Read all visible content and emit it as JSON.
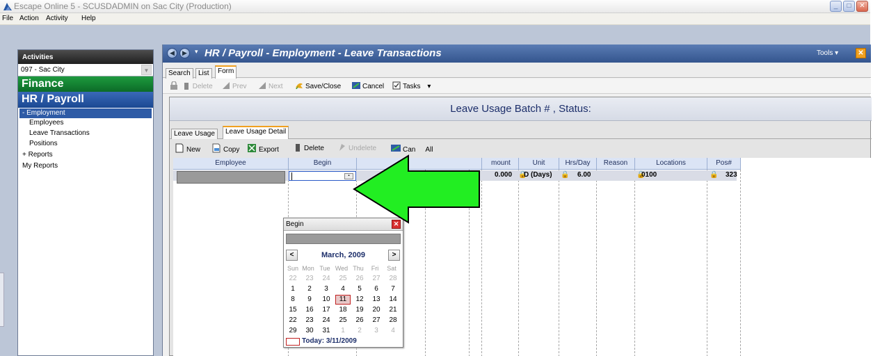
{
  "window": {
    "title": "Escape Online 5 - SCUSDADMIN on Sac City (Production)",
    "min": "_",
    "max": "□",
    "close": "✕"
  },
  "menu": [
    "File",
    "Action",
    "Activity",
    "Help"
  ],
  "activities": {
    "header": "Activities",
    "district": "097 - Sac City",
    "dropdown_glyph": "▼",
    "finance": "Finance",
    "hr": "HR / Payroll",
    "employment": "- Employment",
    "children": [
      "Employees",
      "Leave Transactions",
      "Positions"
    ],
    "reports": "+ Reports",
    "my_reports": "My Reports"
  },
  "main": {
    "back": "◀",
    "forward": "▶",
    "nav_dropdown": "▾",
    "title": "HR / Payroll - Employment - Leave Transactions",
    "tools": "Tools ▾",
    "tools_close": "✕",
    "tabs": [
      "Search",
      "List",
      "Form"
    ],
    "toolbar": {
      "delete": "Delete",
      "prev": "Prev",
      "next": "Next",
      "save_close": "Save/Close",
      "cancel": "Cancel",
      "tasks": "Tasks",
      "tasks_dd": "▾"
    },
    "batch_title": "Leave Usage Batch # , Status:",
    "inner_tabs": [
      "Leave Usage",
      "Leave Usage Detail"
    ],
    "inner_toolbar": {
      "new": "New",
      "copy": "Copy",
      "export": "Export",
      "delete": "Delete",
      "undelete": "Undelete",
      "cancel_all_prefix": "Can",
      "cancel_all_suffix": "All"
    }
  },
  "grid": {
    "headers": [
      "Employee",
      "Begin",
      "mount",
      "Unit",
      "Hrs/Day",
      "Reason",
      "Locations",
      "Pos#"
    ],
    "row": {
      "amount": "0.000",
      "unit": "D (Days)",
      "hrs_day": "6.00",
      "location": "0100",
      "pos": "323"
    },
    "begin_dropdown": "▪"
  },
  "calendar": {
    "title": "Begin",
    "close": "✕",
    "prev": "<",
    "next": ">",
    "month": "March, 2009",
    "weekdays": [
      "Sun",
      "Mon",
      "Tue",
      "Wed",
      "Thu",
      "Fri",
      "Sat"
    ],
    "weeks": [
      [
        "22",
        "23",
        "24",
        "25",
        "26",
        "27",
        "28"
      ],
      [
        "1",
        "2",
        "3",
        "4",
        "5",
        "6",
        "7"
      ],
      [
        "8",
        "9",
        "10",
        "11",
        "12",
        "13",
        "14"
      ],
      [
        "15",
        "16",
        "17",
        "18",
        "19",
        "20",
        "21"
      ],
      [
        "22",
        "23",
        "24",
        "25",
        "26",
        "27",
        "28"
      ],
      [
        "29",
        "30",
        "31",
        "1",
        "2",
        "3",
        "4"
      ]
    ],
    "selected": "11",
    "today": "Today: 3/11/2009"
  },
  "colors": {
    "finance": "#0f7a30",
    "hr": "#2456a4",
    "accent": "#f0a020",
    "arrow": "#22ee22"
  }
}
